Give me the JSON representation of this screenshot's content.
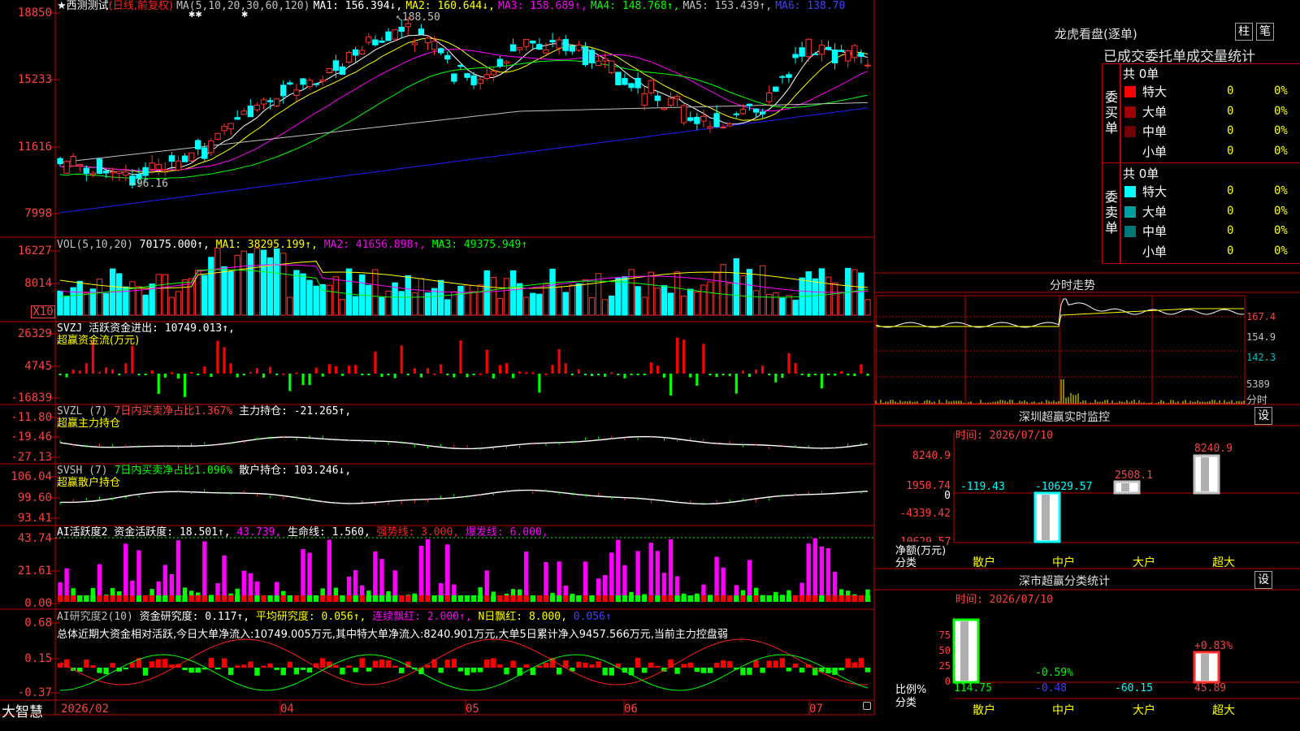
{
  "title": {
    "star": "★",
    "stock_name": "西测测试",
    "period": "(日线,前复权)",
    "ma_params": "MA(5,10,20,30,60,120)",
    "ma1": "MA1: 156.394↓,",
    "ma2": "MA2: 160.644↓,",
    "ma3": "MA3: 158.689↑,",
    "ma4": "MA4: 148.768↑,",
    "ma5": "MA5: 153.439↑,",
    "ma6": "MA6: 138.70"
  },
  "price_axis": [
    "18850",
    "15233",
    "11616",
    "7998"
  ],
  "price_annotations": {
    "high": "188.50",
    "low": "96.16"
  },
  "vol": {
    "header": "VOL(5,10,20)",
    "value": "70175.000↑,",
    "ma1": "MA1: 38295.199↑,",
    "ma2": "MA2: 41656.898↑,",
    "ma3": "MA3: 49375.949↑",
    "axis": [
      "16227",
      "8014"
    ],
    "unit": "X10"
  },
  "svzj": {
    "header": "SVZJ  活跃资金进出: 10749.013↑,",
    "subtitle": "超赢资金流(万元)",
    "axis": [
      "26329",
      "4745",
      "-16839"
    ]
  },
  "svzl": {
    "header_a": "SVZL (7)",
    "header_b": "7日内买卖净占比1.367%",
    "header_c": "主力持仓: -21.265↑,",
    "subtitle": "超赢主力持仓",
    "axis": [
      "-11.80",
      "-19.46",
      "-27.13"
    ]
  },
  "svsh": {
    "header_a": "SVSH (7)",
    "header_b": "7日内买卖净占比1.096%",
    "header_c": "散户持仓: 103.246↓,",
    "subtitle": "超赢散户持仓",
    "axis": [
      "106.04",
      "99.60",
      "93.41"
    ]
  },
  "ai2": {
    "header_a": "AI活跃度2 资金活跃度: 18.501↑,",
    "header_b": "43.739,",
    "header_c": "生命线: 1.560,",
    "header_d": "强势线: 3.000,",
    "header_e": "爆发线: 6.000,",
    "axis": [
      "43.74",
      "21.61",
      "0.00"
    ]
  },
  "ai_research": {
    "header_a": "AI研究度2(10)",
    "header_b": "资金研究度: 0.117↑,",
    "header_c": "平均研究度: 0.056↑,",
    "header_d": "连续飘红: 2.000↑,",
    "header_e": "N日飘红: 8.000,",
    "header_f": "0.056↑",
    "summary": "总体近期大资金相对活跃,今日大单净流入:10749.005万元,其中特大单净流入:8240.901万元,大单5日累计净入9457.566万元,当前主力控盘弱",
    "axis": [
      "0.68",
      "0.15",
      "-0.37"
    ]
  },
  "footer": {
    "brand": "大智慧",
    "dates": [
      "2026/02",
      "04",
      "05",
      "06",
      "07"
    ]
  },
  "dragon": {
    "title": "龙虎看盘(逐单)",
    "tab1": "柱",
    "tab2": "笔",
    "stat_title": "已成交委托单成交量统计",
    "buy_label": "委买单",
    "sell_label": "委卖单",
    "buy_total": "共 0单",
    "sell_total": "共 0单",
    "buy_rows": [
      {
        "name": "特大",
        "count": "0",
        "pct": "0%",
        "color": "#ff0000"
      },
      {
        "name": "大单",
        "count": "0",
        "pct": "0%",
        "color": "#a00000"
      },
      {
        "name": "中单",
        "count": "0",
        "pct": "0%",
        "color": "#700000"
      },
      {
        "name": "小单",
        "count": "0",
        "pct": "0%",
        "color": ""
      }
    ],
    "sell_rows": [
      {
        "name": "特大",
        "count": "0",
        "pct": "0%",
        "color": "#00ffff"
      },
      {
        "name": "大单",
        "count": "0",
        "pct": "0%",
        "color": "#00a0a0"
      },
      {
        "name": "中单",
        "count": "0",
        "pct": "0%",
        "color": "#007878"
      },
      {
        "name": "小单",
        "count": "0",
        "pct": "0%",
        "color": ""
      }
    ]
  },
  "intraday": {
    "title": "分时走势",
    "axis": [
      "167.4",
      "154.9",
      "142.3",
      "5389"
    ],
    "axis_bottom": "分时"
  },
  "monitor": {
    "title": "深圳超赢实时监控",
    "settings": "设",
    "time": "时间: 2026/07/10",
    "axis": [
      "8240.9",
      "1950.74",
      "0",
      "-4339.42",
      "-10629.57"
    ],
    "y_title": "净额(万元)",
    "x_title": "分类",
    "categories": [
      "散户",
      "中户",
      "大户",
      "超大"
    ],
    "values": [
      "-119.43",
      "-10629.57",
      "2508.1",
      "8240.9"
    ]
  },
  "classify": {
    "title": "深市超赢分类统计",
    "settings": "设",
    "time": "时间: 2026/07/10",
    "axis": [
      "75",
      "50",
      "25",
      "0"
    ],
    "y_title": "比例%",
    "x_title": "分类",
    "categories": [
      "散户",
      "中户",
      "大户",
      "超大"
    ],
    "bar_labels": [
      "",
      "-0.59%",
      "",
      "+0.83%"
    ],
    "values": [
      "114.75",
      "-0.48",
      "-60.15",
      "45.89"
    ]
  }
}
